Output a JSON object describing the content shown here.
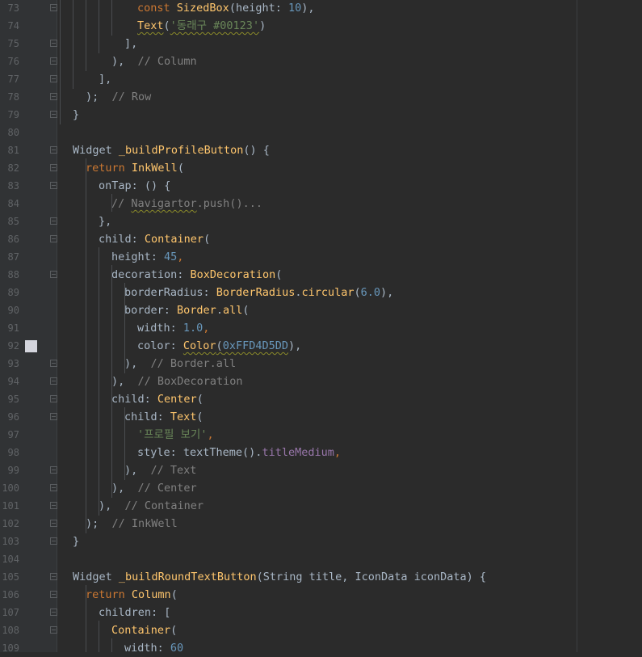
{
  "editor": {
    "lines": [
      {
        "n": "73",
        "indent": 10,
        "tokens": [
          {
            "t": "const ",
            "c": "kw"
          },
          {
            "t": "SizedBox",
            "c": "cls"
          },
          {
            "t": "(height: ",
            "c": "plain"
          },
          {
            "t": "10",
            "c": "num"
          },
          {
            "t": "),",
            "c": "plain"
          }
        ]
      },
      {
        "n": "74",
        "indent": 10,
        "tokens": [
          {
            "t": "Text",
            "c": "cls squig"
          },
          {
            "t": "(",
            "c": "plain"
          },
          {
            "t": "'동래구 #00123'",
            "c": "str squig"
          },
          {
            "t": ")",
            "c": "plain"
          }
        ]
      },
      {
        "n": "75",
        "indent": 8,
        "tokens": [
          {
            "t": "],",
            "c": "plain"
          }
        ]
      },
      {
        "n": "76",
        "indent": 6,
        "tokens": [
          {
            "t": "),  ",
            "c": "plain"
          },
          {
            "t": "// Column",
            "c": "cmt"
          }
        ]
      },
      {
        "n": "77",
        "indent": 4,
        "tokens": [
          {
            "t": "],",
            "c": "plain"
          }
        ]
      },
      {
        "n": "78",
        "indent": 2,
        "tokens": [
          {
            "t": ");  ",
            "c": "plain"
          },
          {
            "t": "// Row",
            "c": "cmt"
          }
        ]
      },
      {
        "n": "79",
        "indent": 0,
        "tokens": [
          {
            "t": "}",
            "c": "plain"
          }
        ]
      },
      {
        "n": "80",
        "indent": 0,
        "tokens": []
      },
      {
        "n": "81",
        "indent": 0,
        "tokens": [
          {
            "t": "Widget ",
            "c": "plain"
          },
          {
            "t": "_buildProfileButton",
            "c": "fn"
          },
          {
            "t": "() {",
            "c": "plain"
          }
        ]
      },
      {
        "n": "82",
        "indent": 2,
        "tokens": [
          {
            "t": "return ",
            "c": "kw"
          },
          {
            "t": "InkWell",
            "c": "cls"
          },
          {
            "t": "(",
            "c": "plain"
          }
        ]
      },
      {
        "n": "83",
        "indent": 4,
        "tokens": [
          {
            "t": "onTap: () {",
            "c": "plain"
          }
        ]
      },
      {
        "n": "84",
        "indent": 6,
        "tokens": [
          {
            "t": "// ",
            "c": "cmt"
          },
          {
            "t": "Navigartor",
            "c": "cmt squig"
          },
          {
            "t": ".push()...",
            "c": "cmt"
          }
        ]
      },
      {
        "n": "85",
        "indent": 4,
        "tokens": [
          {
            "t": "},",
            "c": "plain"
          }
        ]
      },
      {
        "n": "86",
        "indent": 4,
        "tokens": [
          {
            "t": "child: ",
            "c": "plain"
          },
          {
            "t": "Container",
            "c": "cls"
          },
          {
            "t": "(",
            "c": "plain"
          }
        ]
      },
      {
        "n": "87",
        "indent": 6,
        "tokens": [
          {
            "t": "height: ",
            "c": "plain"
          },
          {
            "t": "45",
            "c": "num"
          },
          {
            "t": ",",
            "c": "kw"
          }
        ]
      },
      {
        "n": "88",
        "indent": 6,
        "tokens": [
          {
            "t": "decoration: ",
            "c": "plain"
          },
          {
            "t": "BoxDecoration",
            "c": "cls"
          },
          {
            "t": "(",
            "c": "plain"
          }
        ]
      },
      {
        "n": "89",
        "indent": 8,
        "tokens": [
          {
            "t": "borderRadius: ",
            "c": "plain"
          },
          {
            "t": "BorderRadius",
            "c": "cls"
          },
          {
            "t": ".",
            "c": "plain"
          },
          {
            "t": "circular",
            "c": "fn"
          },
          {
            "t": "(",
            "c": "plain"
          },
          {
            "t": "6.0",
            "c": "num"
          },
          {
            "t": "),",
            "c": "plain"
          }
        ]
      },
      {
        "n": "90",
        "indent": 8,
        "tokens": [
          {
            "t": "border: ",
            "c": "plain"
          },
          {
            "t": "Border",
            "c": "cls"
          },
          {
            "t": ".",
            "c": "plain"
          },
          {
            "t": "all",
            "c": "fn"
          },
          {
            "t": "(",
            "c": "plain"
          }
        ]
      },
      {
        "n": "91",
        "indent": 10,
        "tokens": [
          {
            "t": "width: ",
            "c": "plain"
          },
          {
            "t": "1.0",
            "c": "num"
          },
          {
            "t": ",",
            "c": "kw"
          }
        ]
      },
      {
        "n": "92",
        "indent": 10,
        "tokens": [
          {
            "t": "color: ",
            "c": "plain"
          },
          {
            "t": "Color",
            "c": "cls squig"
          },
          {
            "t": "(",
            "c": "plain squig"
          },
          {
            "t": "0xFFD4D5DD",
            "c": "num squig"
          },
          {
            "t": "),",
            "c": "plain"
          }
        ]
      },
      {
        "n": "93",
        "indent": 8,
        "tokens": [
          {
            "t": "),  ",
            "c": "plain"
          },
          {
            "t": "// Border.all",
            "c": "cmt"
          }
        ]
      },
      {
        "n": "94",
        "indent": 6,
        "tokens": [
          {
            "t": "),  ",
            "c": "plain"
          },
          {
            "t": "// BoxDecoration",
            "c": "cmt"
          }
        ]
      },
      {
        "n": "95",
        "indent": 6,
        "tokens": [
          {
            "t": "child: ",
            "c": "plain"
          },
          {
            "t": "Center",
            "c": "cls"
          },
          {
            "t": "(",
            "c": "plain"
          }
        ]
      },
      {
        "n": "96",
        "indent": 8,
        "tokens": [
          {
            "t": "child: ",
            "c": "plain"
          },
          {
            "t": "Text",
            "c": "cls"
          },
          {
            "t": "(",
            "c": "plain"
          }
        ]
      },
      {
        "n": "97",
        "indent": 10,
        "tokens": [
          {
            "t": "'프로필 보기'",
            "c": "str"
          },
          {
            "t": ",",
            "c": "kw"
          }
        ]
      },
      {
        "n": "98",
        "indent": 10,
        "tokens": [
          {
            "t": "style: textTheme().",
            "c": "plain"
          },
          {
            "t": "titleMedium",
            "c": "prop"
          },
          {
            "t": ",",
            "c": "kw"
          }
        ]
      },
      {
        "n": "99",
        "indent": 8,
        "tokens": [
          {
            "t": "),  ",
            "c": "plain"
          },
          {
            "t": "// Text",
            "c": "cmt"
          }
        ]
      },
      {
        "n": "100",
        "indent": 6,
        "tokens": [
          {
            "t": "),  ",
            "c": "plain"
          },
          {
            "t": "// Center",
            "c": "cmt"
          }
        ]
      },
      {
        "n": "101",
        "indent": 4,
        "tokens": [
          {
            "t": "),  ",
            "c": "plain"
          },
          {
            "t": "// Container",
            "c": "cmt"
          }
        ]
      },
      {
        "n": "102",
        "indent": 2,
        "tokens": [
          {
            "t": ");  ",
            "c": "plain"
          },
          {
            "t": "// InkWell",
            "c": "cmt"
          }
        ]
      },
      {
        "n": "103",
        "indent": 0,
        "tokens": [
          {
            "t": "}",
            "c": "plain"
          }
        ]
      },
      {
        "n": "104",
        "indent": 0,
        "tokens": []
      },
      {
        "n": "105",
        "indent": 0,
        "tokens": [
          {
            "t": "Widget ",
            "c": "plain"
          },
          {
            "t": "_buildRoundTextButton",
            "c": "fn"
          },
          {
            "t": "(String title, IconData iconData) {",
            "c": "plain"
          }
        ]
      },
      {
        "n": "106",
        "indent": 2,
        "tokens": [
          {
            "t": "return ",
            "c": "kw"
          },
          {
            "t": "Column",
            "c": "cls"
          },
          {
            "t": "(",
            "c": "plain"
          }
        ]
      },
      {
        "n": "107",
        "indent": 4,
        "tokens": [
          {
            "t": "children: [",
            "c": "plain"
          }
        ]
      },
      {
        "n": "108",
        "indent": 6,
        "tokens": [
          {
            "t": "Container",
            "c": "cls"
          },
          {
            "t": "(",
            "c": "plain"
          }
        ]
      },
      {
        "n": "109",
        "indent": 8,
        "tokens": [
          {
            "t": "width: ",
            "c": "plain"
          },
          {
            "t": "60",
            "c": "num"
          }
        ]
      }
    ],
    "fold_lines": [
      "73",
      "75",
      "76",
      "77",
      "78",
      "79",
      "81",
      "82",
      "83",
      "85",
      "86",
      "88",
      "93",
      "94",
      "95",
      "96",
      "99",
      "100",
      "101",
      "102",
      "103",
      "105",
      "106",
      "107",
      "108"
    ],
    "color_swatch": {
      "line": "92",
      "color": "#D4D5DD"
    }
  }
}
